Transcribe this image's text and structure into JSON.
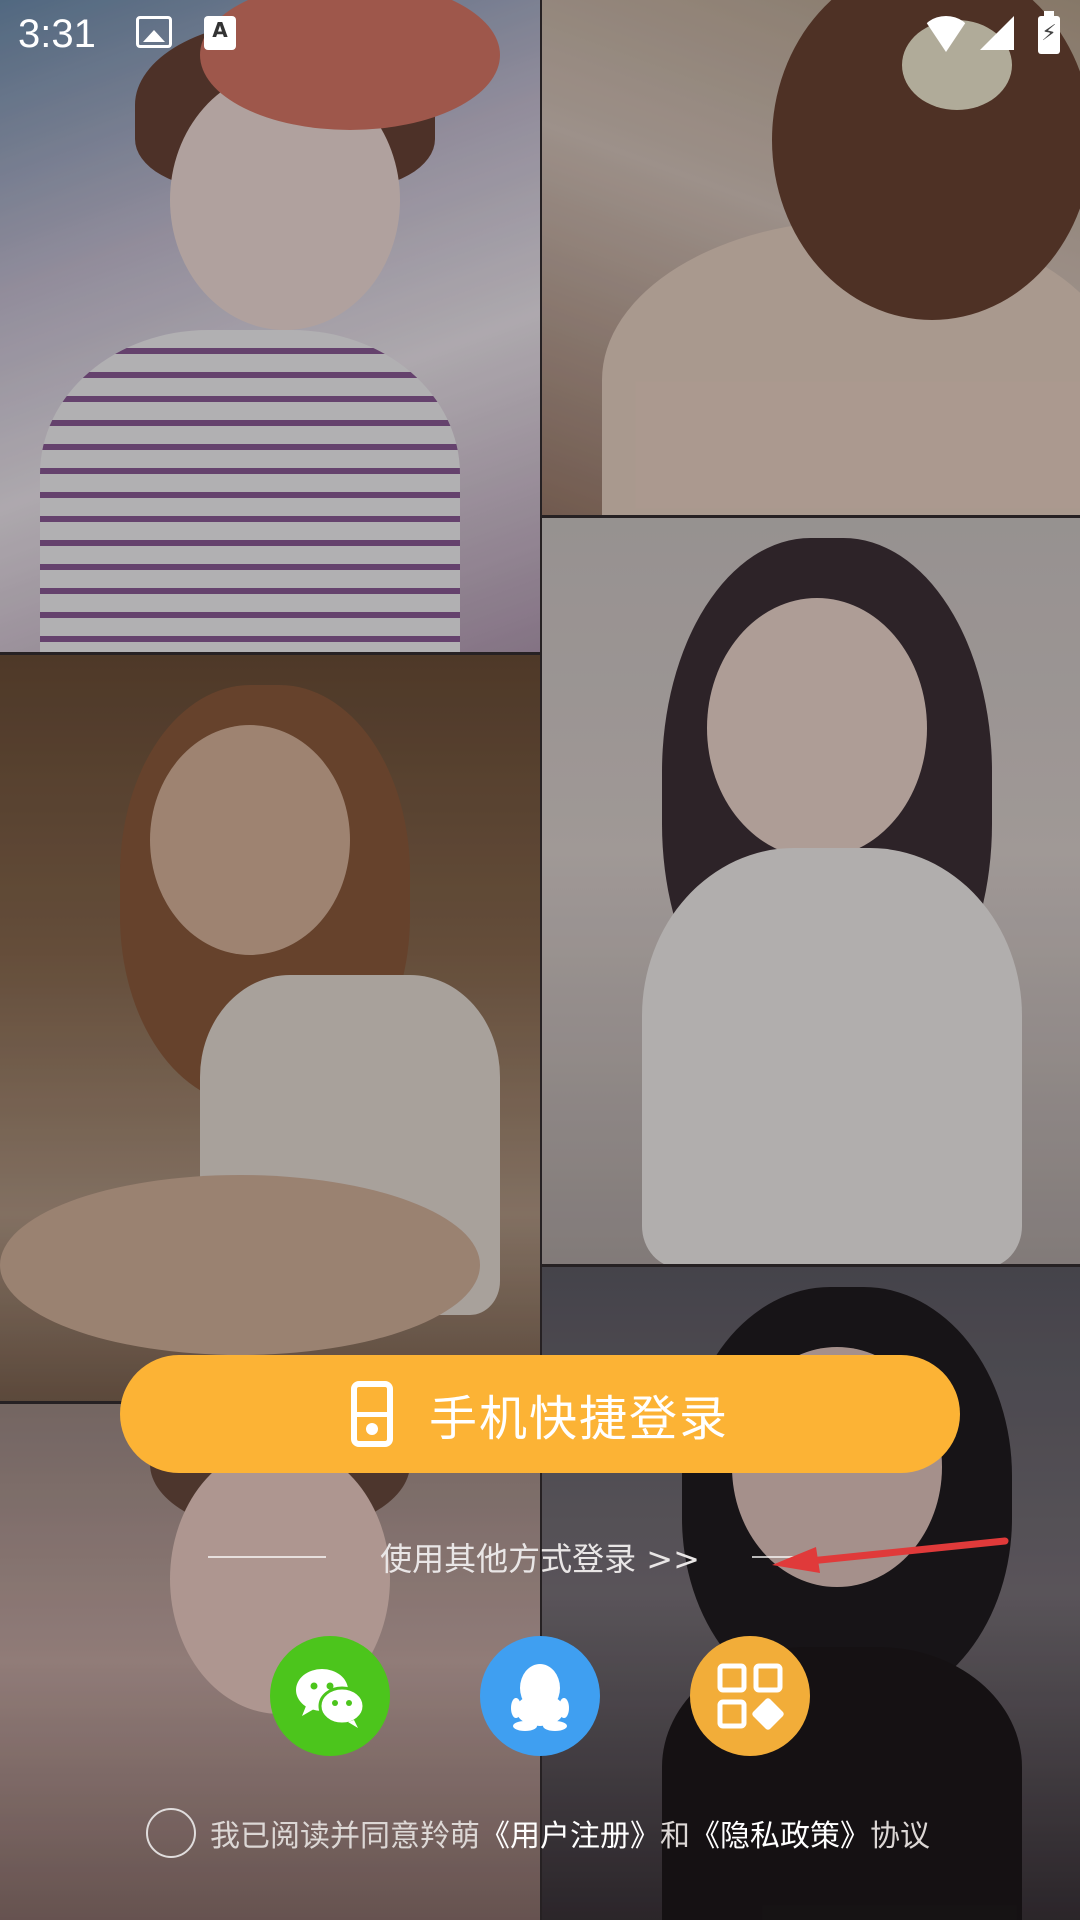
{
  "status_bar": {
    "time": "3:31",
    "icons": [
      "image-icon",
      "a-notification-icon",
      "wifi-icon",
      "signal-icon",
      "battery-charging-icon"
    ]
  },
  "background": {
    "panels": [
      "photo-1",
      "photo-2",
      "photo-3",
      "photo-4",
      "photo-5",
      "photo-6"
    ]
  },
  "login": {
    "phone_button_label": "手机快捷登录",
    "other_methods": "使用其他方式登录 >>"
  },
  "social": {
    "wechat": "wechat-icon",
    "qq": "qq-icon",
    "more": "apps-icon"
  },
  "agreement": {
    "prefix": "我已阅读并同意羚萌",
    "user_link": "《用户注册》",
    "and": "和",
    "privacy_link": "《隐私政策》",
    "suffix": "协议"
  },
  "colors": {
    "primary_button": "#fcb335",
    "wechat": "#4cc51c",
    "qq": "#3f9ff1",
    "more": "#f2ad39",
    "annotation_arrow": "#e03a3a"
  }
}
